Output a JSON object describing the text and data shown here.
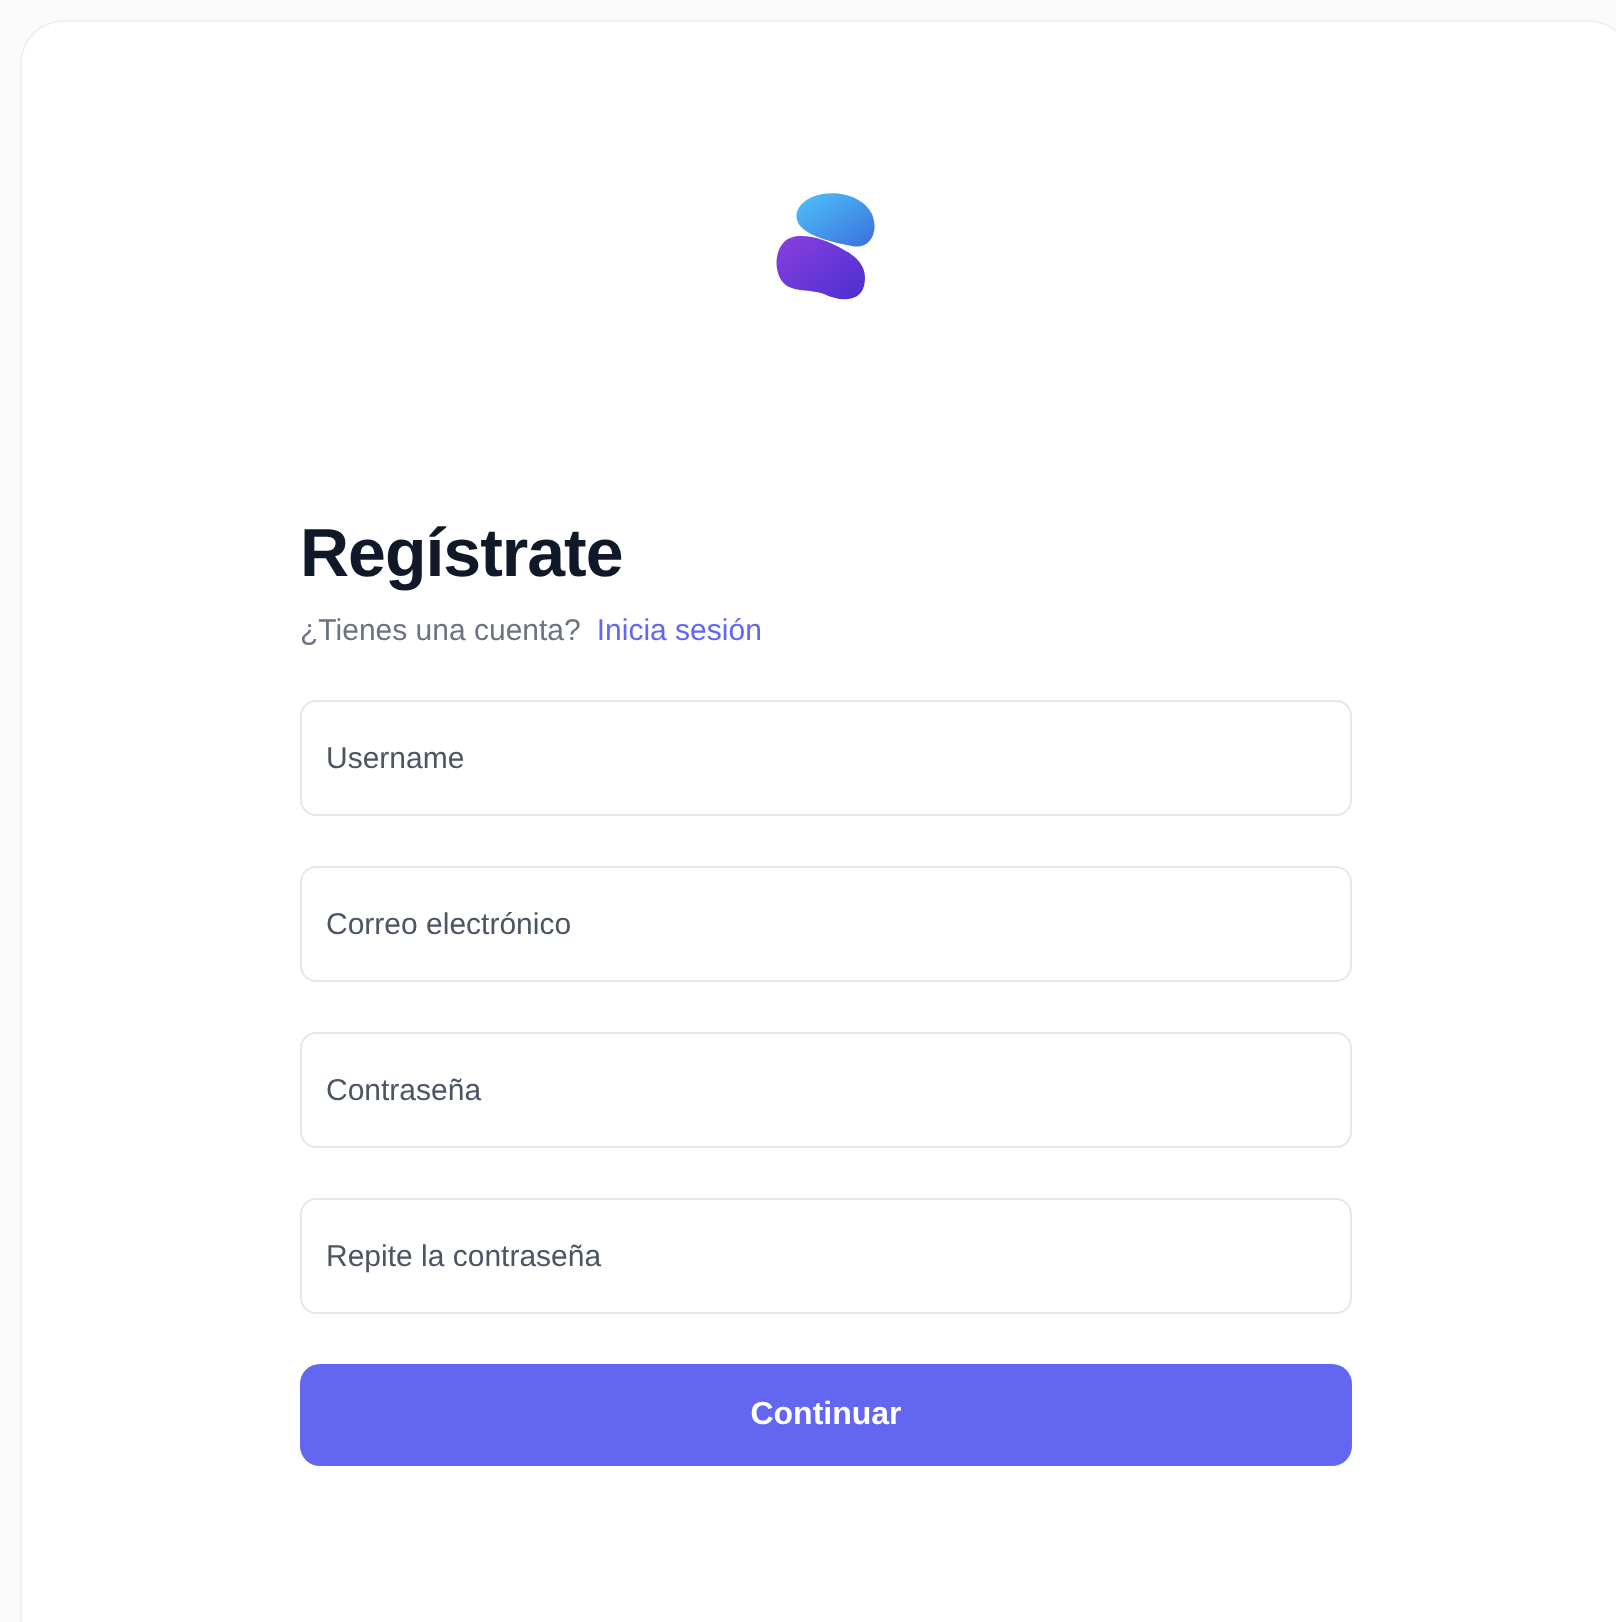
{
  "title": "Regístrate",
  "account_prompt": {
    "text": "¿Tienes una cuenta?",
    "link": "Inicia sesión"
  },
  "fields": [
    {
      "placeholder": "Username"
    },
    {
      "placeholder": "Correo electrónico"
    },
    {
      "placeholder": "Contraseña"
    },
    {
      "placeholder": "Repite la contraseña"
    }
  ],
  "submit": "Continuar"
}
